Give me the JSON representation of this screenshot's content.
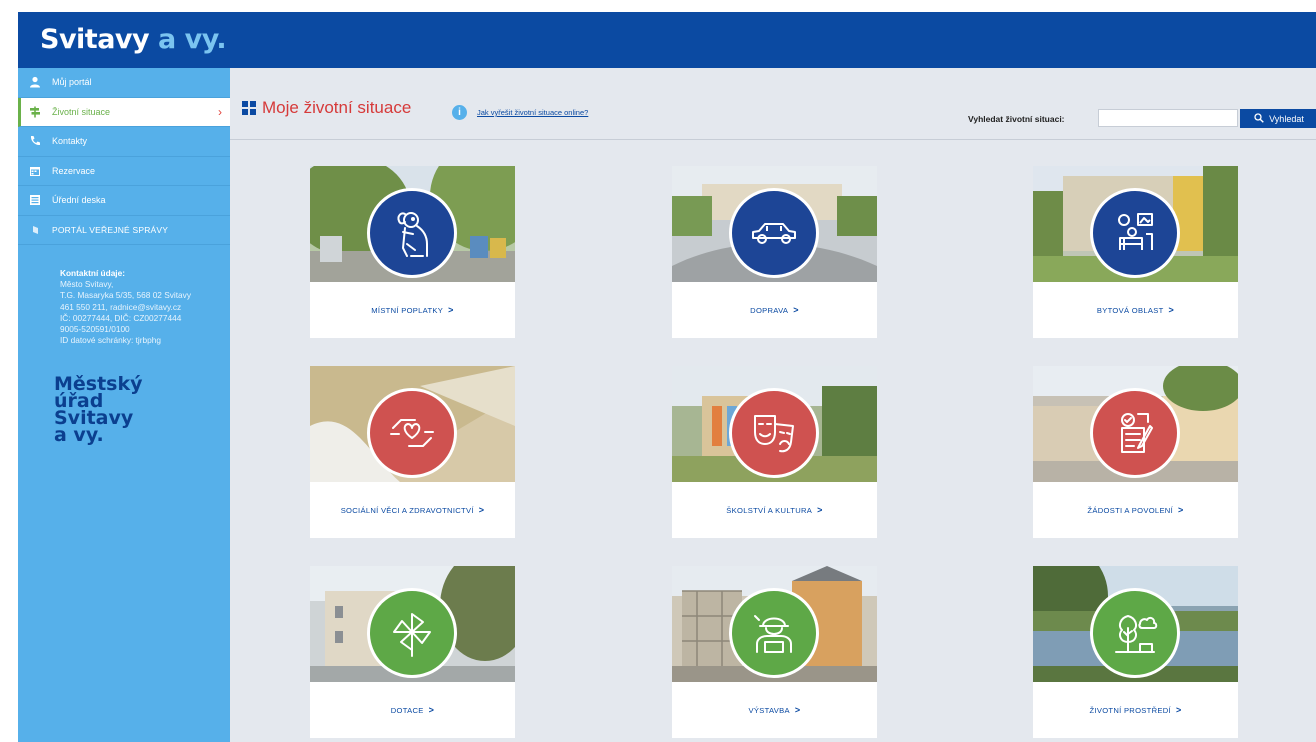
{
  "header": {
    "logo_main": "Svitavy",
    "logo_accent": "a vy."
  },
  "sidebar": {
    "items": [
      {
        "label": "Můj portál"
      },
      {
        "label": "Životní situace"
      },
      {
        "label": "Kontakty"
      },
      {
        "label": "Rezervace"
      },
      {
        "label": "Úřední deska"
      },
      {
        "label": "PORTÁL VEŘEJNÉ SPRÁVY"
      }
    ],
    "contact": {
      "title": "Kontaktní údaje:",
      "lines": [
        "Město Svitavy,",
        "T.G. Masaryka 5/35, 568 02 Svitavy",
        "461 550 211, radnice@svitavy.cz",
        "IČ: 00277444, DIČ: CZ00277444",
        "9005-520591/0100",
        "ID datové schránky: tjrbphg"
      ]
    },
    "brand_lines": [
      "Městský",
      "úřad",
      "Svitavy",
      "a vy."
    ]
  },
  "main": {
    "title": "Moje životní situace",
    "help_link": "Jak vyřešit životní situace online?",
    "search": {
      "label": "Vyhledat životní situaci:",
      "value": "",
      "button": "Vyhledat"
    }
  },
  "cards": [
    {
      "label": "MÍSTNÍ POPLATKY",
      "icon": "dog-icon",
      "color": "#1d4596"
    },
    {
      "label": "DOPRAVA",
      "icon": "car-icon",
      "color": "#1d4596"
    },
    {
      "label": "BYTOVÁ OBLAST",
      "icon": "home-office-icon",
      "color": "#1d4596"
    },
    {
      "label": "SOCIÁLNÍ VĚCI A ZDRAVOTNICTVÍ",
      "icon": "hands-heart-icon",
      "color": "#cf5250"
    },
    {
      "label": "ŠKOLSTVÍ A KULTURA",
      "icon": "theater-masks-icon",
      "color": "#cf5250"
    },
    {
      "label": "ŽÁDOSTI A POVOLENÍ",
      "icon": "application-form-icon",
      "color": "#cf5250"
    },
    {
      "label": "DOTACE",
      "icon": "pinwheel-icon",
      "color": "#5ea847"
    },
    {
      "label": "VÝSTAVBA",
      "icon": "construction-worker-icon",
      "color": "#5ea847"
    },
    {
      "label": "ŽIVOTNÍ PROSTŘEDÍ",
      "icon": "tree-cloud-icon",
      "color": "#5ea847"
    }
  ],
  "card_arrow": ">"
}
